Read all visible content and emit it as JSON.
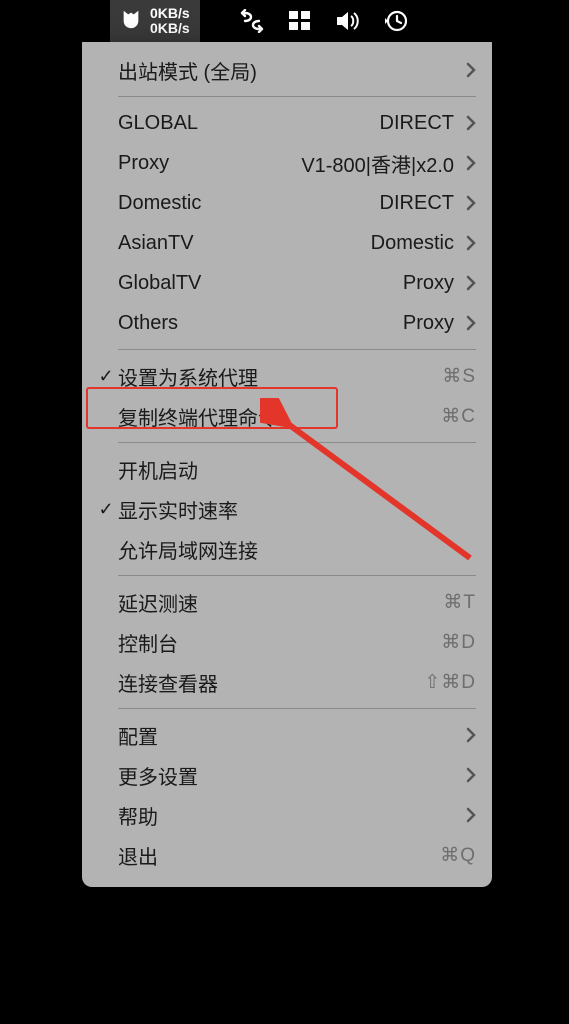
{
  "menubar": {
    "speed_up": "0KB/s",
    "speed_down": "0KB/s"
  },
  "menu": {
    "outbound_mode": {
      "label": "出站模式 (全局)"
    },
    "rules": [
      {
        "label": "GLOBAL",
        "value": "DIRECT"
      },
      {
        "label": "Proxy",
        "value": "V1-800|香港|x2.0"
      },
      {
        "label": "Domestic",
        "value": "DIRECT"
      },
      {
        "label": "AsianTV",
        "value": "Domestic"
      },
      {
        "label": "GlobalTV",
        "value": "Proxy"
      },
      {
        "label": "Others",
        "value": "Proxy"
      }
    ],
    "set_system_proxy": {
      "label": "设置为系统代理",
      "shortcut": "⌘S",
      "checked": true
    },
    "copy_terminal_cmd": {
      "label": "复制终端代理命令",
      "shortcut": "⌘C"
    },
    "launch_at_login": {
      "label": "开机启动"
    },
    "show_realtime_rate": {
      "label": "显示实时速率",
      "checked": true
    },
    "allow_lan": {
      "label": "允许局域网连接"
    },
    "latency_test": {
      "label": "延迟测速",
      "shortcut": "⌘T"
    },
    "dashboard": {
      "label": "控制台",
      "shortcut": "⌘D"
    },
    "conn_viewer": {
      "label": "连接查看器",
      "shortcut": "⇧⌘D"
    },
    "config": {
      "label": "配置"
    },
    "more_settings": {
      "label": "更多设置"
    },
    "help": {
      "label": "帮助"
    },
    "quit": {
      "label": "退出",
      "shortcut": "⌘Q"
    }
  }
}
